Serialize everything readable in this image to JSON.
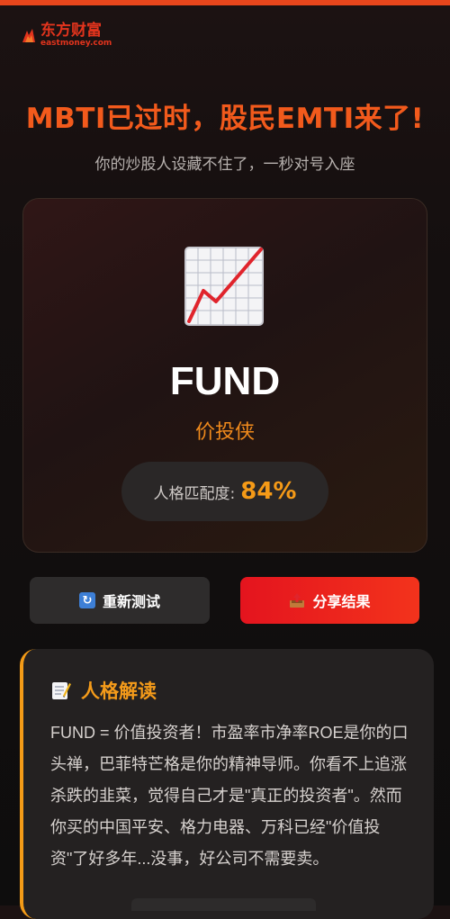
{
  "brand": {
    "name_cn": "东方财富",
    "name_en": "eastmoney.com",
    "color": "#e2341d"
  },
  "header": {
    "title": "MBTI已过时，股民EMTI来了!",
    "subtitle": "你的炒股人设藏不住了，一秒对号入座"
  },
  "result": {
    "icon": "chart-increasing-icon",
    "code": "FUND",
    "name": "价投侠",
    "match_label": "人格匹配度:",
    "match_value": "84%"
  },
  "actions": {
    "retest_label": "重新测试",
    "retest_icon": "refresh-icon",
    "share_label": "分享结果",
    "share_icon": "outbox-tray-icon"
  },
  "interpretation": {
    "icon": "memo-icon",
    "title": "人格解读",
    "body": "FUND = 价值投资者！市盈率市净率ROE是你的口头禅，巴菲特芒格是你的精神导师。你看不上追涨杀跌的韭菜，觉得自己才是\"真正的投资者\"。然而你买的中国平安、格力电器、万科已经\"价值投资\"了好多年...没事，好公司不需要卖。"
  },
  "colors": {
    "accent": "#f25a1c",
    "highlight": "#f59a17",
    "share_button": "#e4141e"
  }
}
